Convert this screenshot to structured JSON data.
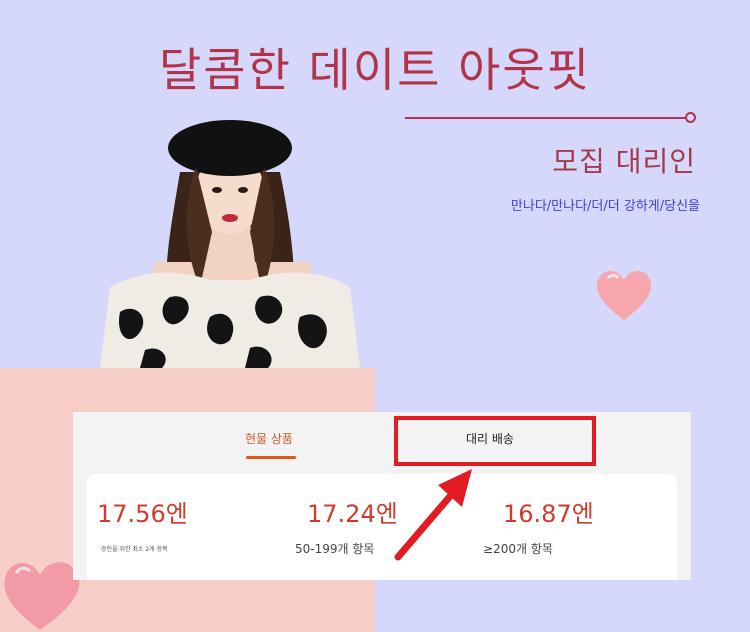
{
  "banner": {
    "title": "달콤한 데이트 아웃핏",
    "subtitle": "모집 대리인",
    "tagline": "만나다/만나다/더/더 강하게/당신을"
  },
  "tabs": [
    {
      "label": "현물 상품",
      "active": true
    },
    {
      "label": "대리 배송",
      "active": false,
      "highlighted": true
    }
  ],
  "prices": [
    {
      "value": "17.56엔",
      "note": "승인을 위한 최소 2개 항목"
    },
    {
      "value": "17.24엔",
      "note": "50-199개 항목"
    },
    {
      "value": "16.87엔",
      "note": "≥200개 항목"
    }
  ],
  "colors": {
    "background": "#d6d8fb",
    "title": "#b2344a",
    "price": "#d23b2c",
    "active_tab": "#e0561d",
    "highlight": "#e21c22"
  }
}
